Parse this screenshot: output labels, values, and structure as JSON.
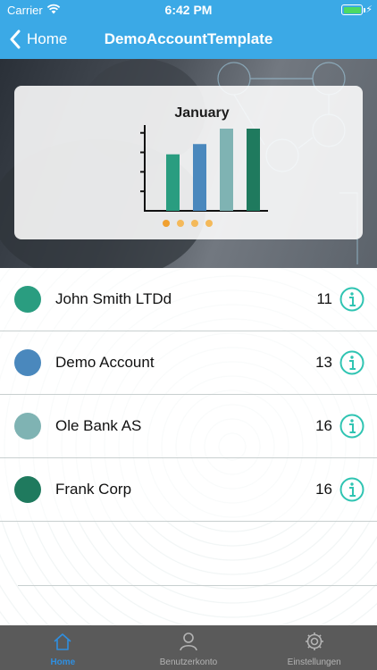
{
  "status_bar": {
    "carrier": "Carrier",
    "time": "6:42 PM",
    "battery_color": "#4cd964"
  },
  "nav": {
    "back_label": "Home",
    "title": "DemoAccountTemplate",
    "bar_color": "#3ba9e6"
  },
  "hero_chart": {
    "title": "January",
    "pager_dots": 4,
    "active_dot": 0
  },
  "chart_data": {
    "type": "bar",
    "title": "January",
    "categories": [
      "John Smith LTDd",
      "Demo Account",
      "Ole Bank AS",
      "Frank Corp"
    ],
    "values": [
      11,
      13,
      16,
      16
    ],
    "colors": [
      "#2a9d80",
      "#4a88bd",
      "#7fb3b3",
      "#1f7a5e"
    ],
    "xlabel": "",
    "ylabel": "",
    "ylim": [
      0,
      16
    ]
  },
  "accounts": [
    {
      "name": "John Smith LTDd",
      "count": "11",
      "color": "#2a9d80"
    },
    {
      "name": "Demo Account",
      "count": "13",
      "color": "#4a88bd"
    },
    {
      "name": "Ole Bank AS",
      "count": "16",
      "color": "#7fb3b3"
    },
    {
      "name": "Frank Corp",
      "count": "16",
      "color": "#1f7a5e"
    }
  ],
  "info_icon_color": "#2fc4b2",
  "tabs": [
    {
      "label": "Home",
      "icon": "home-icon",
      "active": true
    },
    {
      "label": "Benutzerkonto",
      "icon": "user-icon",
      "active": false
    },
    {
      "label": "Einstellungen",
      "icon": "gear-icon",
      "active": false
    }
  ]
}
